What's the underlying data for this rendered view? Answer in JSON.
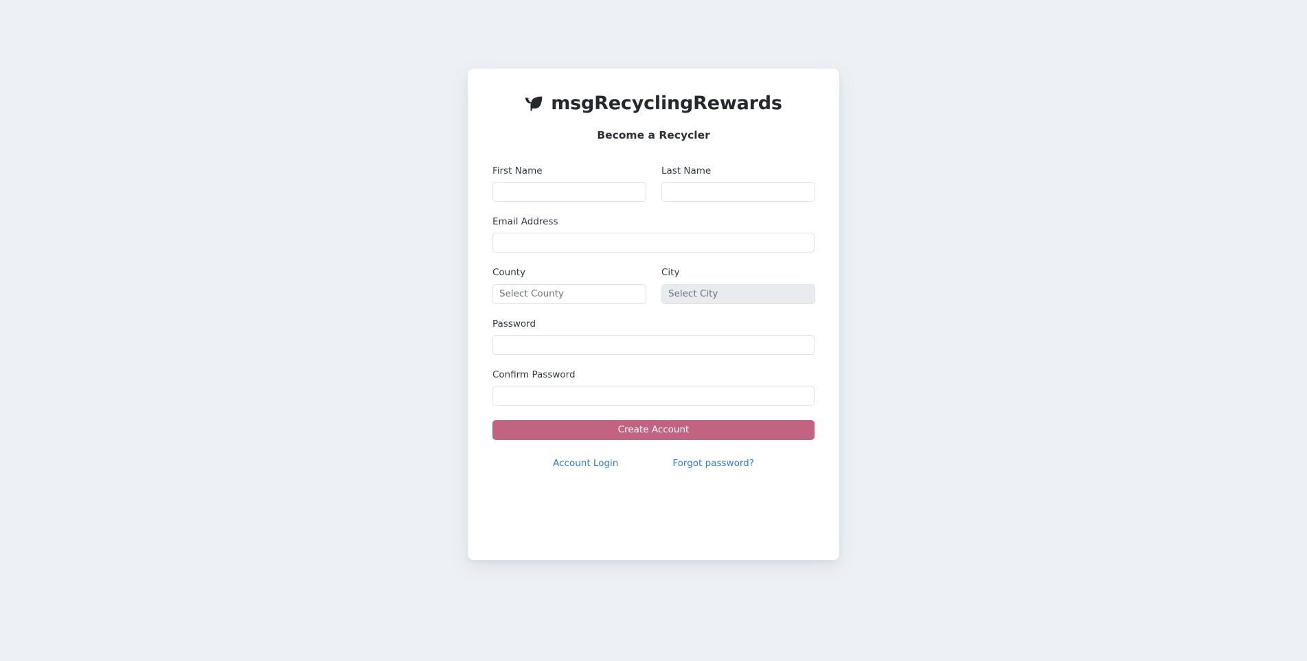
{
  "background_color": "#edf1f5",
  "brand": {
    "icon": "leaf-icon",
    "title": "msgRecyclingRewards",
    "title_color": "#24292f"
  },
  "subtitle": "Become a Recycler",
  "form": {
    "fields": {
      "first_name": {
        "label": "First Name",
        "value": "",
        "placeholder": ""
      },
      "last_name": {
        "label": "Last Name",
        "value": "",
        "placeholder": ""
      },
      "email": {
        "label": "Email Address",
        "value": "",
        "placeholder": ""
      },
      "county": {
        "label": "County",
        "selected": "Select County",
        "disabled": false
      },
      "city": {
        "label": "City",
        "selected": "Select City",
        "disabled": true
      },
      "password": {
        "label": "Password",
        "value": "",
        "placeholder": ""
      },
      "confirm_password": {
        "label": "Confirm Password",
        "value": "",
        "placeholder": ""
      }
    },
    "submit": {
      "label": "Create Account",
      "color": "#c26382"
    }
  },
  "links": {
    "account_login": "Account Login",
    "forgot_password": "Forgot password?",
    "color": "#2b7cf0"
  }
}
